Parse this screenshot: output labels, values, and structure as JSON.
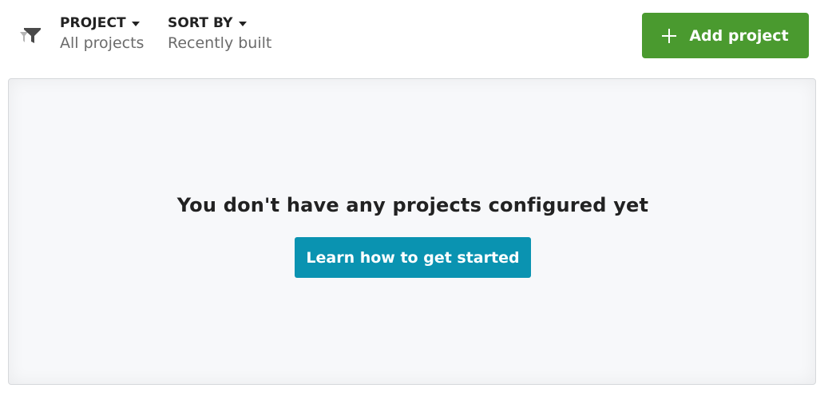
{
  "toolbar": {
    "filter_icon": "filter-icon",
    "project_filter": {
      "label": "PROJECT",
      "value": "All projects"
    },
    "sort_filter": {
      "label": "SORT BY",
      "value": "Recently built"
    },
    "add_button": {
      "label": "Add project",
      "icon": "plus-icon",
      "color": "#4a9a2f"
    }
  },
  "empty_state": {
    "message": "You don't have any projects configured yet",
    "cta_label": "Learn how to get started",
    "cta_color": "#0a93b1"
  }
}
